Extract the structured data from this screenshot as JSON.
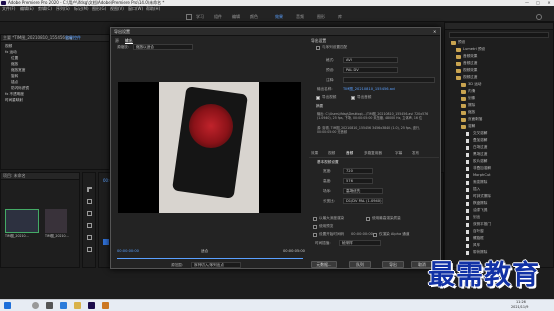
{
  "window": {
    "title": "Adobe Premiere Pro 2020 - C:\\用户\\ifdsg\\文档\\Adobe\\Premiere Pro\\14.0\\未命名 *",
    "minimize": "—",
    "maximize": "□",
    "close": "✕"
  },
  "menu": [
    "文件(F)",
    "编辑(E)",
    "剪辑(C)",
    "序列(S)",
    "标记(M)",
    "图形(G)",
    "视图(V)",
    "窗口(W)",
    "帮助(H)"
  ],
  "workspaces": [
    "学习",
    "组件",
    "编辑",
    "颜色",
    "效果",
    "音频",
    "图形",
    "库"
  ],
  "workspace_active": "效果",
  "left_panel": {
    "tab": "主要 *TIM图_20210810_155456.jpg",
    "tab2": "效果控件",
    "rows": [
      "视频",
      "fx 运动",
      "位置",
      "缩放",
      "缩放宽度",
      "旋转",
      "锚点",
      "防闪烁滤镜",
      "fx 不透明度",
      "时间重映射"
    ]
  },
  "project_panel": {
    "title": "项目: 未命名",
    "item1": "TIM图_20210...",
    "item2": "TIM图_20210..."
  },
  "dialog": {
    "title": "导出设置",
    "source_tab": "源",
    "output_tab": "输出",
    "source_scaling_label": "源缩放:",
    "source_scaling_value": "缩放以适合",
    "section_export": "导出设置",
    "match_seq_label": "与序列设置匹配",
    "format_label": "格式:",
    "format_value": "AVI",
    "preset_label": "预设:",
    "preset_value": "PAL DV",
    "comment_label": "注释:",
    "output_name_label": "输出名称:",
    "output_name_value": "TIM图_20210810_155456.avi",
    "export_video_label": "导出视频",
    "export_audio_label": "导出音频",
    "summary_label": "摘要",
    "summary_output": "输出: C:\\Users\\ifdsg\\Desktop\\...\\TIM图_20210810_155456.avi 720x576 (1.0940), 25 fps, 下场, 00:00:05:00 未压缩, 48000 Hz, 立体声, 16 位",
    "summary_source": "源: 剪辑, TIM图_20210810_155456 3456x3840 (1.0), 25 fps, 逐行, 00:00:05:00 无音频",
    "tabs": [
      "效果",
      "视频",
      "音频",
      "多路复用器",
      "字幕",
      "发布"
    ],
    "tab_active": "视频",
    "video_codec_section": "基本视频设置",
    "width_label": "宽度:",
    "width_value": "720",
    "height_label": "高度:",
    "height_value": "576",
    "frame_rate_label": "帧速率:",
    "frame_rate_value": "25",
    "field_order_label": "场序:",
    "field_order_value": "高场优先",
    "aspect_label": "长宽比:",
    "aspect_value": "D1/DV PAL (1.0940)",
    "render_max_depth_label": "以最大深度渲染",
    "max_quality_label": "使用最高渲染质量",
    "use_previews_label": "使用预览",
    "import_project_label": "导入项目中",
    "set_start_tc_label": "设置开始时间码",
    "start_tc_value": "00:00:00:00",
    "render_alpha_label": "仅渲染 Alpha 通道",
    "time_interp_label": "时间插值:",
    "time_interp_value": "帧采样",
    "metadata_btn": "元数据...",
    "queue_btn": "队列",
    "export_btn": "导出",
    "cancel_btn": "取消",
    "timecode_left": "00:00:00:00",
    "fit_label": "适合",
    "timecode_right": "00:00:05:00",
    "source_range_label": "源范围:",
    "source_range_value": "序列切入/序列出点"
  },
  "timeline": {
    "tc": "00:00:00:00"
  },
  "file_tree": {
    "items": [
      "预设",
      "Lumetri 预设",
      "音频效果",
      "音频过渡",
      "视频效果",
      "视频过渡",
      "3D 运动",
      "内滑",
      "划像",
      "擦除",
      "缩放",
      "页面剥落",
      "溶解",
      "交叉溶解",
      "叠加溶解",
      "白场过渡",
      "黑场过渡",
      "胶片溶解",
      "非叠加溶解",
      "MorphCut",
      "渐变擦除",
      "插入",
      "时钟式擦除",
      "棋盘擦除",
      "油漆飞溅",
      "划出",
      "双侧平推门",
      "百叶窗",
      "螺旋框",
      "风车",
      "带状擦除"
    ]
  },
  "taskbar": {
    "time": "11:26",
    "date": "2021/11/9"
  },
  "watermark": "最需教育"
}
